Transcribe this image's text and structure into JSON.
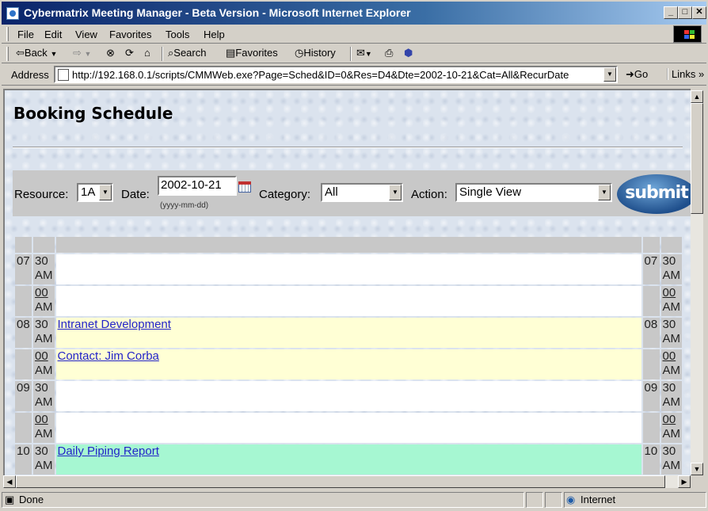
{
  "window": {
    "title": "Cybermatrix Meeting Manager - Beta Version - Microsoft Internet Explorer"
  },
  "menu": [
    "File",
    "Edit",
    "View",
    "Favorites",
    "Tools",
    "Help"
  ],
  "toolbar": {
    "back": "Back",
    "search": "Search",
    "favorites": "Favorites",
    "history": "History"
  },
  "address": {
    "label": "Address",
    "url": "http://192.168.0.1/scripts/CMMWeb.exe?Page=Sched&ID=0&Res=D4&Dte=2002-10-21&Cat=All&RecurDate",
    "go": "Go",
    "links": "Links"
  },
  "page": {
    "title": "Booking Schedule",
    "resource_label": "Resource:",
    "resource_value": "1A",
    "date_label": "Date:",
    "date_value": "2002-10-21",
    "date_hint": "(yyyy-mm-dd)",
    "category_label": "Category:",
    "category_value": "All",
    "action_label": "Action:",
    "action_value": "Single View",
    "submit": "submit"
  },
  "schedule": {
    "rows": [
      {
        "hour": "07",
        "min": "30",
        "ampm": "AM",
        "min_link": false,
        "event": "",
        "bg": "white"
      },
      {
        "hour": "",
        "min": "00",
        "ampm": "AM",
        "min_link": true,
        "event": "",
        "bg": "white"
      },
      {
        "hour": "08",
        "min": "30",
        "ampm": "AM",
        "min_link": false,
        "event": "Intranet Development",
        "bg": "yellow"
      },
      {
        "hour": "",
        "min": "00",
        "ampm": "AM",
        "min_link": true,
        "event": "Contact: Jim Corba",
        "bg": "yellow"
      },
      {
        "hour": "09",
        "min": "30",
        "ampm": "AM",
        "min_link": false,
        "event": "",
        "bg": "white"
      },
      {
        "hour": "",
        "min": "00",
        "ampm": "AM",
        "min_link": true,
        "event": "",
        "bg": "white"
      },
      {
        "hour": "10",
        "min": "30",
        "ampm": "AM",
        "min_link": false,
        "event": "Daily Piping Report",
        "bg": "green"
      }
    ]
  },
  "status": {
    "text": "Done",
    "zone": "Internet"
  },
  "colors": {
    "event_yellow": "#ffffd5",
    "event_green": "#a6f7d2",
    "link": "#2323c8"
  }
}
